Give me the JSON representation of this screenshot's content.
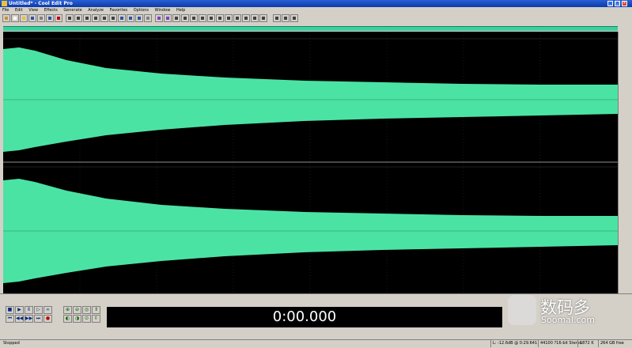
{
  "window": {
    "title": "Untitled* - Cool Edit Pro"
  },
  "menu": {
    "items": [
      "File",
      "Edit",
      "View",
      "Effects",
      "Generate",
      "Analyze",
      "Favorites",
      "Options",
      "Window",
      "Help"
    ]
  },
  "time_display": {
    "value": "0:00.000"
  },
  "status_bar": {
    "state": "Stopped",
    "level": "L: -12.6dB @ 0:29.641",
    "format": "44100 ?16-bit Stereo",
    "size": "1872 K",
    "free": "264 GB free"
  },
  "watermark": {
    "cn": "数码多",
    "en": "Soomal.com"
  },
  "colors": {
    "waveform": "#4be3a3",
    "background": "#000000"
  }
}
